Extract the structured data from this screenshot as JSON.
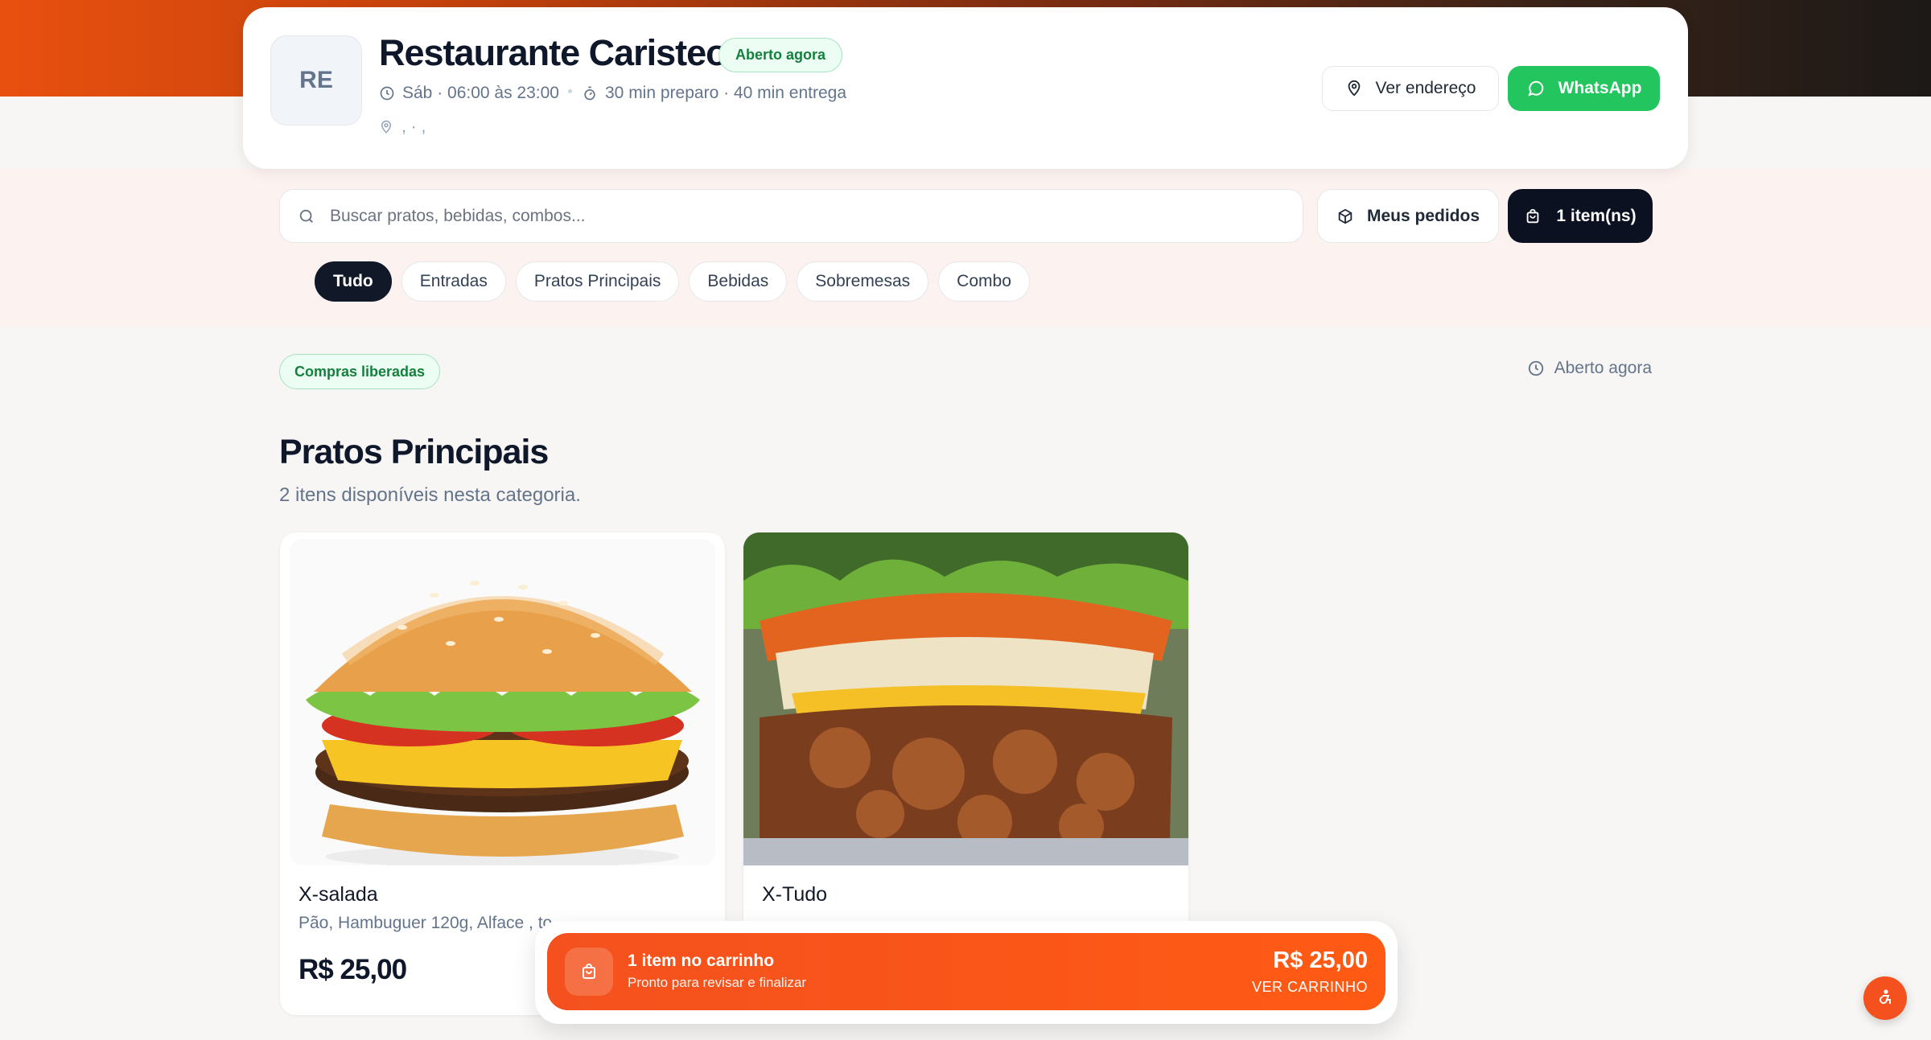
{
  "restaurant": {
    "initials": "RE",
    "name": "Restaurante Caristeo",
    "status_badge": "Aberto agora",
    "hours": "Sáb · 06:00 às 23:00",
    "timing": "30 min preparo · 40 min entrega",
    "address": ", · ,"
  },
  "header_actions": {
    "address_label": "Ver endereço",
    "whatsapp_label": "WhatsApp"
  },
  "search": {
    "placeholder": "Buscar pratos, bebidas, combos...",
    "value": ""
  },
  "toolbar": {
    "orders_label": "Meus pedidos",
    "cart_label": "1 item(ns)"
  },
  "categories": [
    "Tudo",
    "Entradas",
    "Pratos Principais",
    "Bebidas",
    "Sobremesas",
    "Combo"
  ],
  "active_category": "Tudo",
  "store_status": {
    "purchase_badge": "Compras liberadas",
    "open_label": "Aberto agora"
  },
  "section": {
    "title": "Pratos Principais",
    "subtitle": "2 itens disponíveis nesta categoria."
  },
  "products": [
    {
      "name": "X-salada",
      "description": "Pão, Hambuguer 120g, Alface , to",
      "price": "R$ 25,00"
    },
    {
      "name": "X-Tudo",
      "description": "",
      "price": ""
    }
  ],
  "cart_bar": {
    "title": "1 item no carrinho",
    "subtitle": "Pronto para revisar e finalizar",
    "total": "R$ 25,00",
    "link": "VER CARRINHO"
  },
  "colors": {
    "accent": "#f4511e",
    "whatsapp": "#22c55e",
    "dark": "#0b1120",
    "success": "#15803d"
  },
  "icons": [
    "clock-icon",
    "timer-icon",
    "map-pin-icon",
    "chat-bubble-icon",
    "search-icon",
    "package-icon",
    "shopping-bag-icon",
    "accessibility-icon"
  ]
}
